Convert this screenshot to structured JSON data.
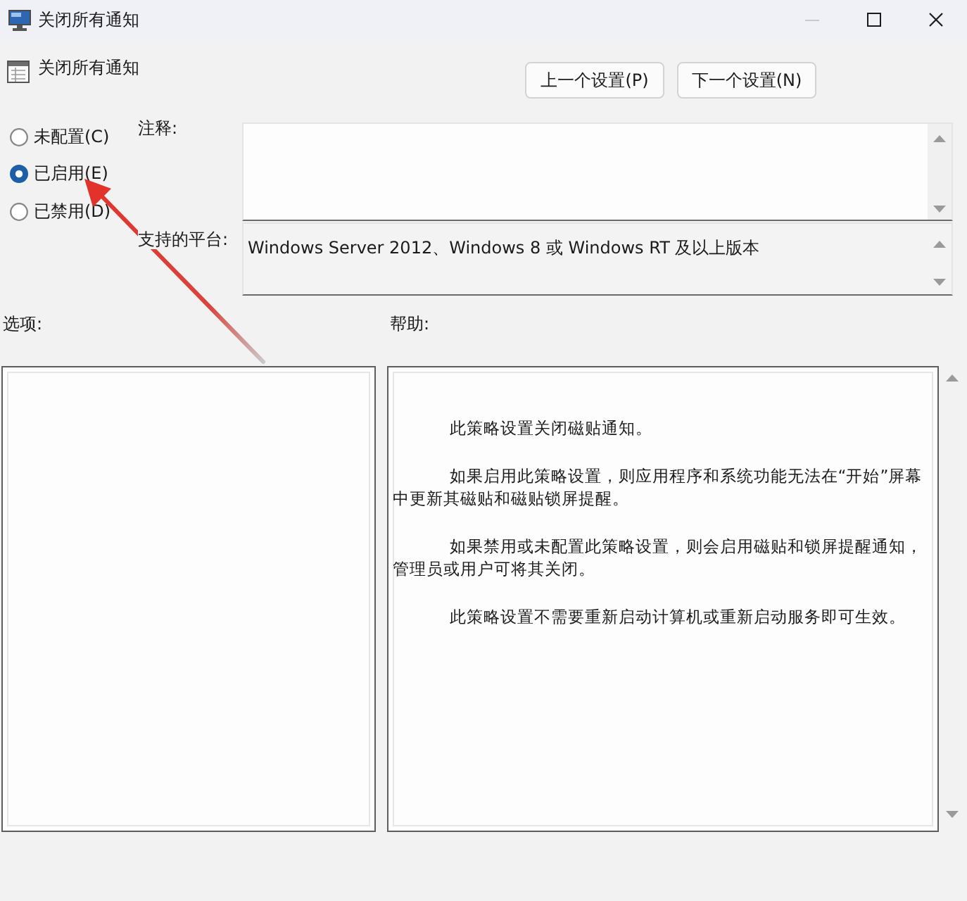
{
  "window": {
    "title": "关闭所有通知",
    "controls": [
      {
        "kind": "minimize",
        "disabled": true
      },
      {
        "kind": "maximize",
        "disabled": false
      },
      {
        "kind": "close",
        "disabled": false
      }
    ]
  },
  "header": {
    "title": "关闭所有通知",
    "buttons": [
      "上一个设置(P)",
      "下一个设置(N)"
    ]
  },
  "state_options": [
    {
      "label": "未配置(C)",
      "selected": false
    },
    {
      "label": "已启用(E)",
      "selected": true
    },
    {
      "label": "已禁用(D)",
      "selected": false
    }
  ],
  "comment": {
    "label": "注释:"
  },
  "supported_platforms": {
    "label": "支持的平台:",
    "value": "Windows Server 2012、Windows 8 或 Windows RT 及以上版本"
  },
  "options": {
    "label": "选项:"
  },
  "help": {
    "label": "帮助:",
    "paragraphs": [
      "此策略设置关闭磁贴通知。",
      "如果启用此策略设置，则应用程序和系统功能无法在“开始”屏幕中更新其磁贴和磁贴锁屏提醒。",
      "如果禁用或未配置此策略设置，则会启用磁贴和锁屏提醒通知，管理员或用户可将其关闭。",
      "此策略设置不需要重新启动计算机或重新启动服务即可生效。"
    ]
  }
}
